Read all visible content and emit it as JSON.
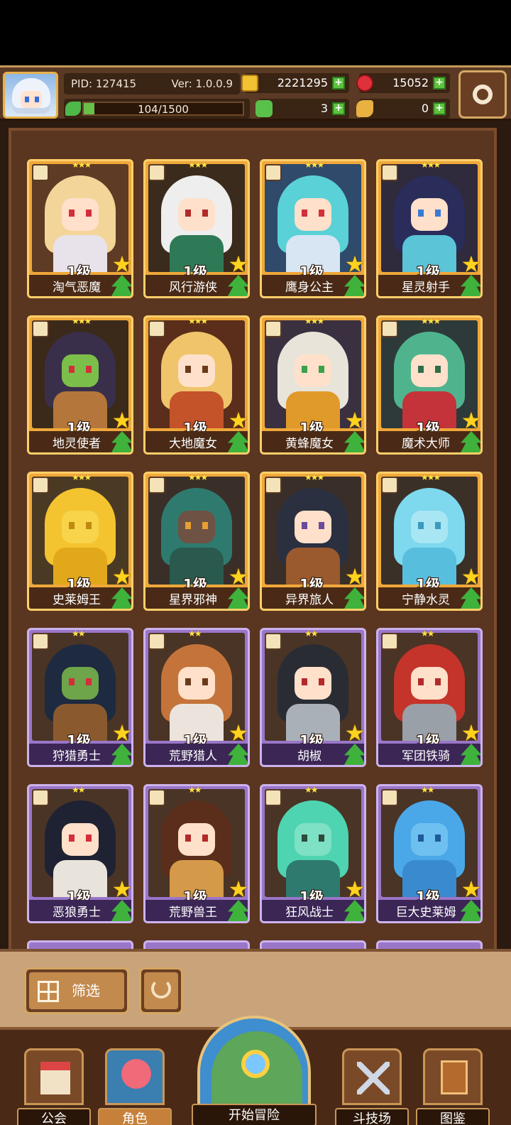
{
  "header": {
    "pid": "PID: 127415",
    "version": "Ver: 1.0.0.9",
    "exp": "104/1500",
    "exp_fraction": 0.069,
    "coins": "2221295",
    "gems": "15052",
    "clovers": "3",
    "bread": "0"
  },
  "cards": [
    {
      "name": "淘气恶魔",
      "level": "1级",
      "stars": "★★★",
      "rarity": "gold",
      "hair": "#f3d59a",
      "skin": "#ffe0ca",
      "outfit": "#e8e3ea",
      "bg": "#5e3b24",
      "eye": "#d42e3a"
    },
    {
      "name": "风行游侠",
      "level": "1级",
      "stars": "★★★",
      "rarity": "gold",
      "hair": "#eeeeee",
      "skin": "#ffe0ca",
      "outfit": "#2f7a56",
      "bg": "#3a2b1c",
      "eye": "#b22a2a"
    },
    {
      "name": "鹰身公主",
      "level": "1级",
      "stars": "★★★",
      "rarity": "gold",
      "hair": "#5ad1d6",
      "skin": "#ffe0ca",
      "outfit": "#d8e6f3",
      "bg": "#2f4a6a",
      "eye": "#d42e3a"
    },
    {
      "name": "星灵射手",
      "level": "1级",
      "stars": "★★★",
      "rarity": "gold",
      "hair": "#2a2c5a",
      "skin": "#ffe0ca",
      "outfit": "#5bc4d7",
      "bg": "#2f2a3c",
      "eye": "#3a7ad6"
    },
    {
      "name": "地灵使者",
      "level": "1级",
      "stars": "★★★",
      "rarity": "gold",
      "hair": "#3a2f4a",
      "skin": "#7bbf4a",
      "outfit": "#b4763a",
      "bg": "#3b2a1a",
      "eye": "#d42e3a"
    },
    {
      "name": "大地魔女",
      "level": "1级",
      "stars": "★★★",
      "rarity": "gold",
      "hair": "#f0c46a",
      "skin": "#ffe0ca",
      "outfit": "#c4532a",
      "bg": "#5a2e1a",
      "eye": "#6a3a1a"
    },
    {
      "name": "黄蜂魔女",
      "level": "1级",
      "stars": "★★★",
      "rarity": "gold",
      "hair": "#e8e4da",
      "skin": "#ffe0ca",
      "outfit": "#e09a2a",
      "bg": "#3a3040",
      "eye": "#3aa04a"
    },
    {
      "name": "魔术大师",
      "level": "1级",
      "stars": "★★★",
      "rarity": "gold",
      "hair": "#4fb48e",
      "skin": "#ffe0ca",
      "outfit": "#c4333a",
      "bg": "#2e3a3a",
      "eye": "#2e6e4a"
    },
    {
      "name": "史莱姆王",
      "level": "1级",
      "stars": "★★★",
      "rarity": "gold",
      "hair": "#f4c430",
      "skin": "#f7d44a",
      "outfit": "#e2a81c",
      "bg": "#4a3a24",
      "eye": "#c08a10"
    },
    {
      "name": "星界邪神",
      "level": "1级",
      "stars": "★★★",
      "rarity": "gold",
      "hair": "#2f7a6e",
      "skin": "#6e5244",
      "outfit": "#2a5a4e",
      "bg": "#3a2f28",
      "eye": "#e8a030"
    },
    {
      "name": "异界旅人",
      "level": "1级",
      "stars": "★★★",
      "rarity": "gold",
      "hair": "#2a3040",
      "skin": "#ffe0ca",
      "outfit": "#9a5a2e",
      "bg": "#3a2e28",
      "eye": "#6a4a9a"
    },
    {
      "name": "宁静水灵",
      "level": "1级",
      "stars": "★★★",
      "rarity": "gold",
      "hair": "#7ed8ee",
      "skin": "#a8e6f4",
      "outfit": "#58bede",
      "bg": "#3a3028",
      "eye": "#3a9ac0"
    },
    {
      "name": "狩猎勇士",
      "level": "1级",
      "stars": "★★",
      "rarity": "purple",
      "hair": "#1e2a40",
      "skin": "#6ea44a",
      "outfit": "#8a5a2e",
      "bg": "#4a3426",
      "eye": "#d42e3a"
    },
    {
      "name": "荒野猎人",
      "level": "1级",
      "stars": "★★",
      "rarity": "purple",
      "hair": "#c4743a",
      "skin": "#ffe0ca",
      "outfit": "#ece4dc",
      "bg": "#4a3426",
      "eye": "#6a3a1a"
    },
    {
      "name": "胡椒",
      "level": "1级",
      "stars": "★★",
      "rarity": "purple",
      "hair": "#2a2c34",
      "skin": "#ffe0ca",
      "outfit": "#aab0b8",
      "bg": "#4a3426",
      "eye": "#b22a2a"
    },
    {
      "name": "军团铁骑",
      "level": "1级",
      "stars": "★★",
      "rarity": "purple",
      "hair": "#c4342a",
      "skin": "#ffe0ca",
      "outfit": "#9aa0a8",
      "bg": "#4a3426",
      "eye": "#b22a2a"
    },
    {
      "name": "恶狼勇士",
      "level": "1级",
      "stars": "★★",
      "rarity": "purple",
      "hair": "#1e2232",
      "skin": "#ffe0ca",
      "outfit": "#e8e4dc",
      "bg": "#4a3426",
      "eye": "#d42e3a"
    },
    {
      "name": "荒野兽王",
      "level": "1级",
      "stars": "★★",
      "rarity": "purple",
      "hair": "#5a2e1a",
      "skin": "#ffe0ca",
      "outfit": "#d49a4a",
      "bg": "#4a3426",
      "eye": "#b22a2a"
    },
    {
      "name": "狂风战士",
      "level": "1级",
      "stars": "★★",
      "rarity": "purple",
      "hair": "#4ed4b0",
      "skin": "#7ee0c4",
      "outfit": "#2e7a6e",
      "bg": "#4a3426",
      "eye": "#2e4a3a"
    },
    {
      "name": "巨大史莱姆",
      "level": "1级",
      "stars": "★★",
      "rarity": "purple",
      "hair": "#4aa8e8",
      "skin": "#6ec0f0",
      "outfit": "#3a8ad0",
      "bg": "#4a3426",
      "eye": "#1e5a9a"
    }
  ],
  "filter": {
    "label": "筛选"
  },
  "nav": {
    "guild": "公会",
    "characters": "角色",
    "adventure": "开始冒险",
    "arena": "斗技场",
    "codex": "图鉴"
  },
  "colors": {
    "header_bg": "#5a3a24",
    "panel_bg": "#5a3620",
    "gold_frame": "#f0a83a",
    "purple_frame": "#9a76c8",
    "plus_green": "#5fc23f"
  }
}
